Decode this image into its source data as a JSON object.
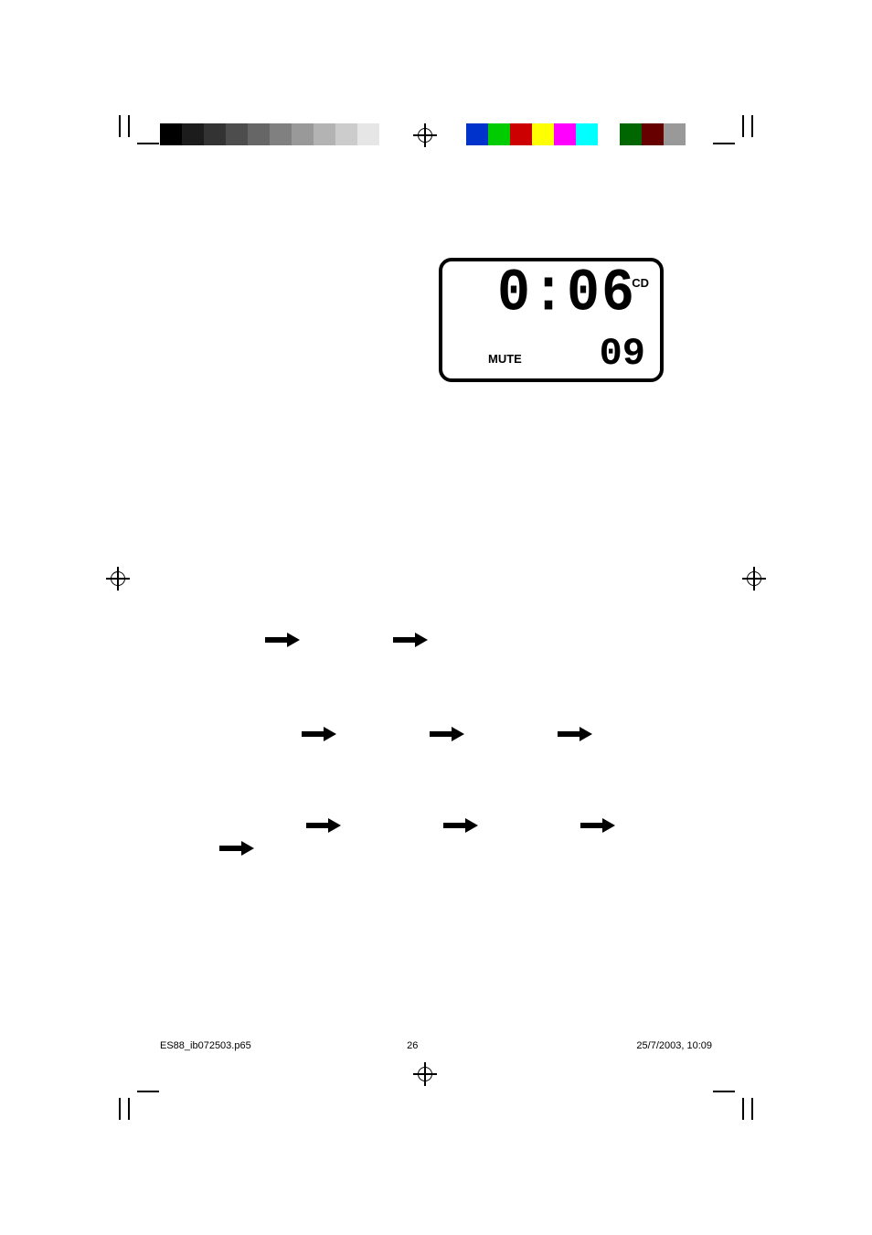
{
  "lcd": {
    "time": "0:06",
    "mode": "CD",
    "mute_label": "MUTE",
    "track": "09"
  },
  "swatches": {
    "gray": [
      "#000000",
      "#1c1c1c",
      "#333333",
      "#4d4d4d",
      "#666666",
      "#808080",
      "#999999",
      "#b3b3b3",
      "#cccccc",
      "#e6e6e6",
      "#ffffff"
    ],
    "color": [
      "#0033cc",
      "#00cc00",
      "#cc0000",
      "#ffff00",
      "#ff00ff",
      "#00ffff",
      "#ffffff",
      "#006600",
      "#660000",
      "#999999"
    ]
  },
  "footer": {
    "filename": "ES88_ib072503.p65",
    "page": "26",
    "datetime": "25/7/2003, 10:09"
  }
}
